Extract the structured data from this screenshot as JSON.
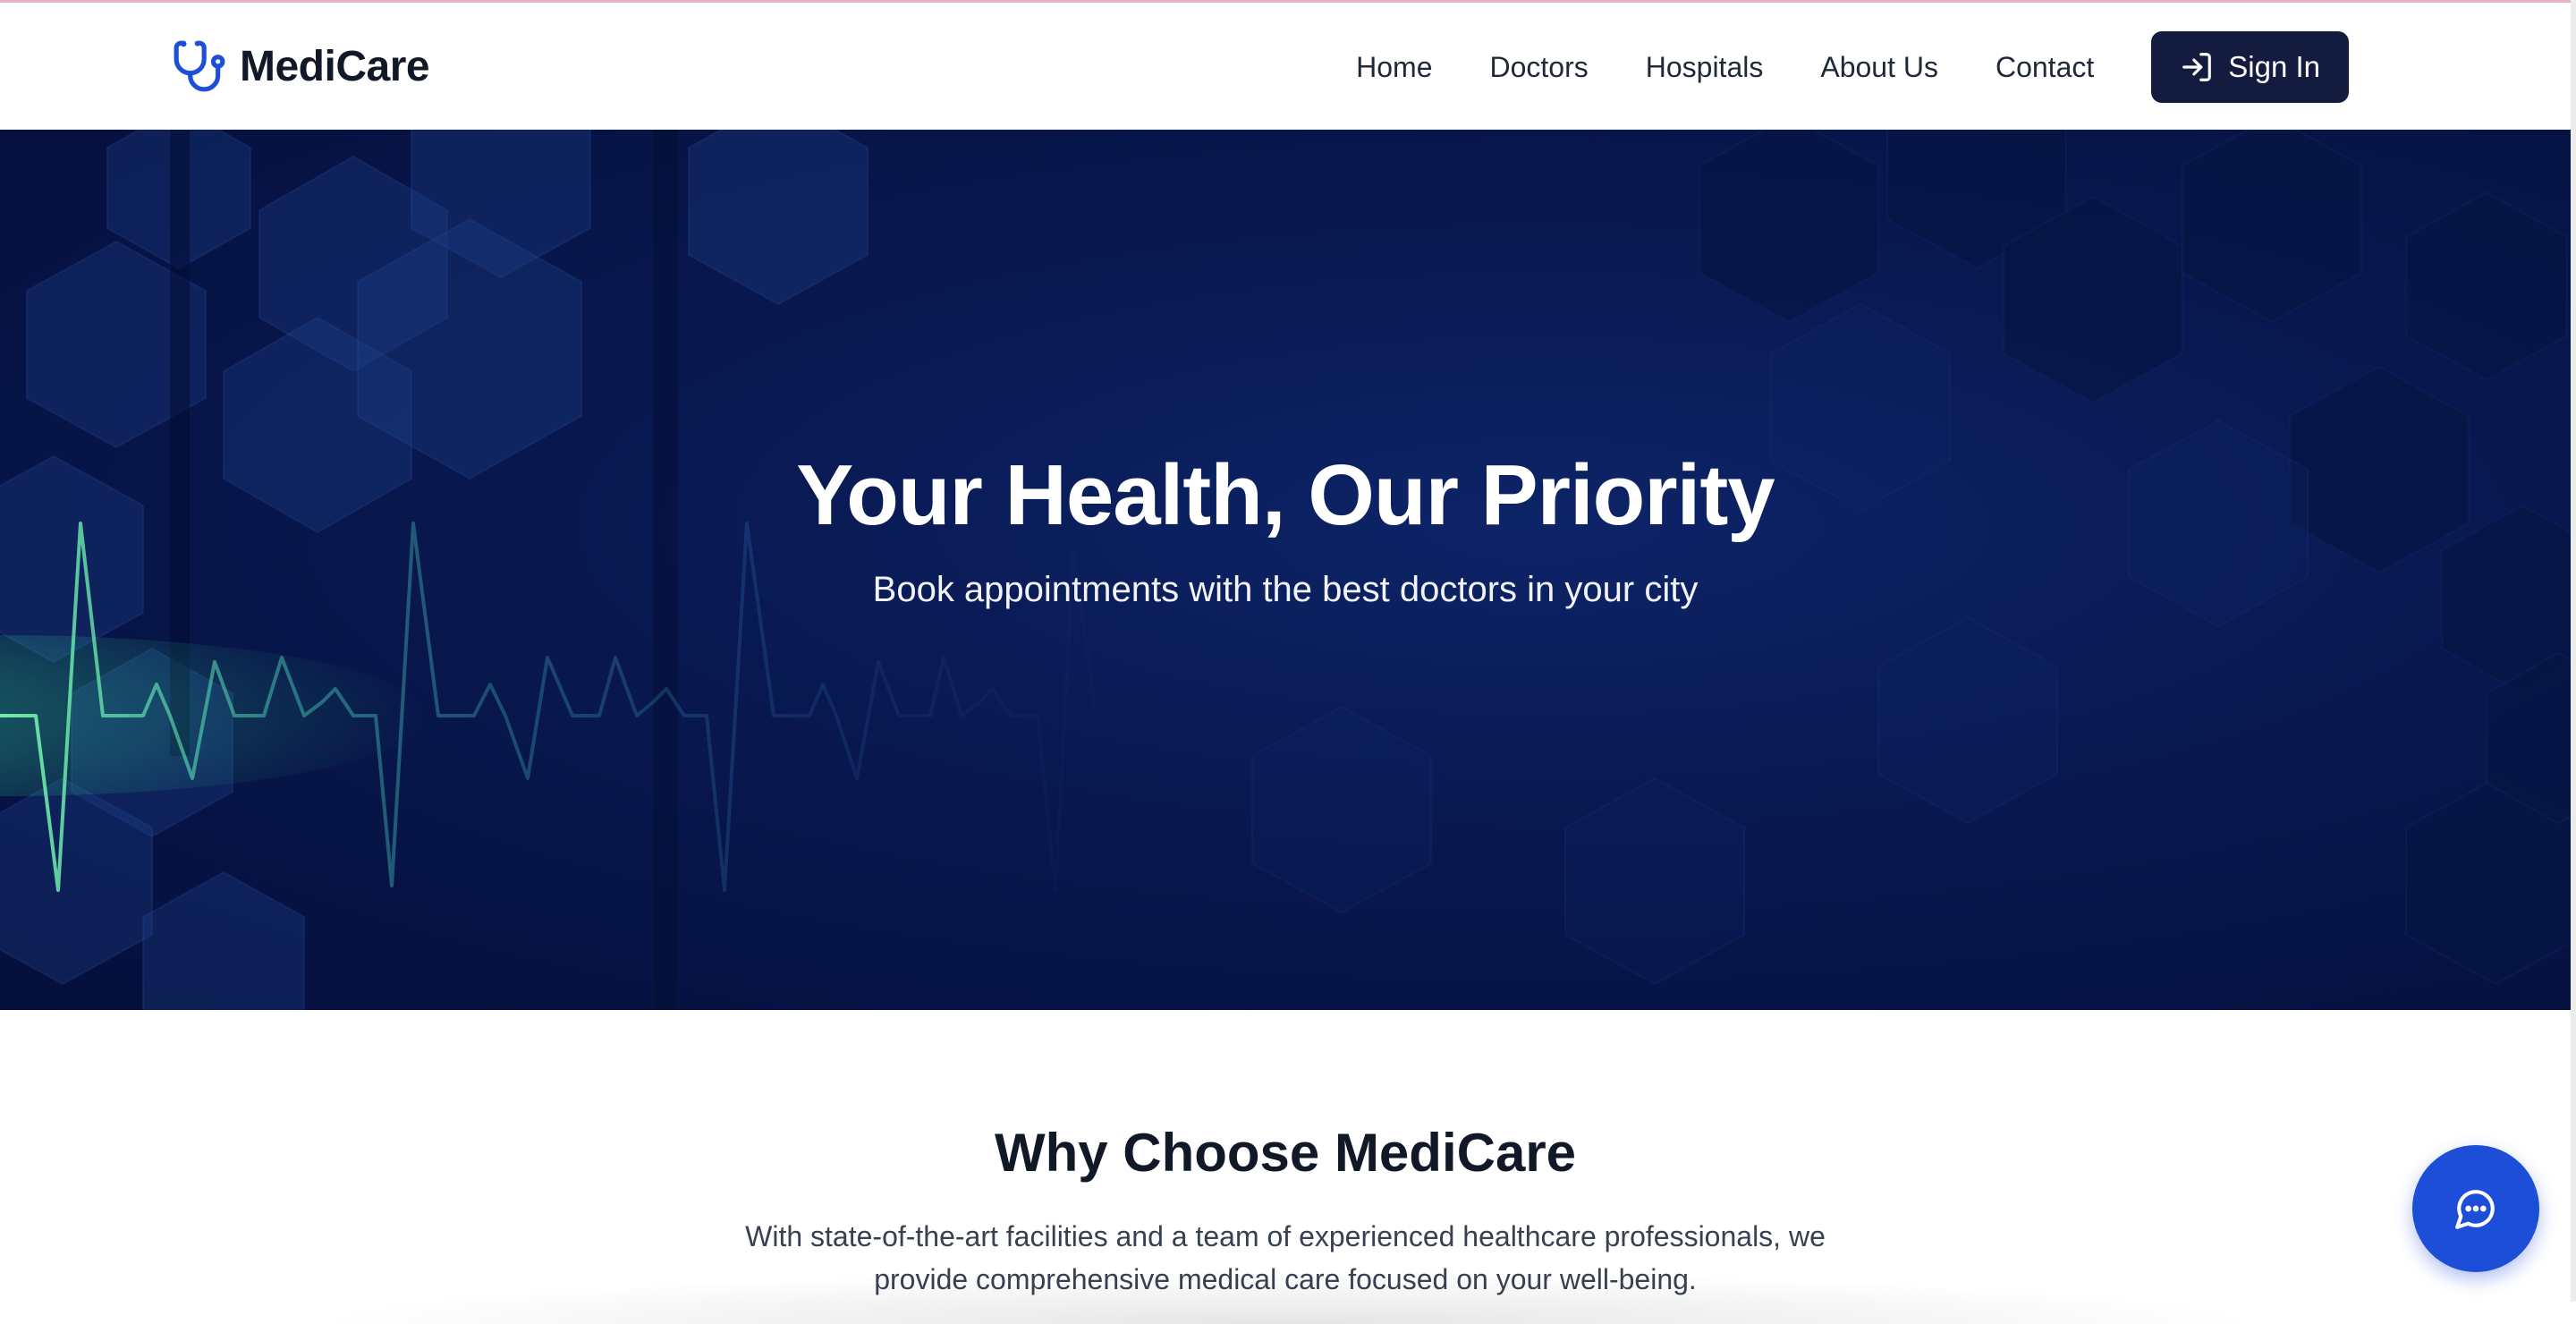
{
  "app": {
    "brand_name": "MediCare",
    "brand_icon": "stethoscope-icon",
    "accent_color": "#1d4ed8",
    "navy_color": "#131b3e"
  },
  "nav": {
    "links": [
      "Home",
      "Doctors",
      "Hospitals",
      "About Us",
      "Contact"
    ],
    "signin_label": "Sign In",
    "signin_icon": "sign-in-arrow-icon"
  },
  "hero": {
    "title": "Your Health, Our Priority",
    "subtitle": "Book appointments with the best doctors in your city"
  },
  "why": {
    "title": "Why Choose MediCare",
    "text": "With state-of-the-art facilities and a team of experienced healthcare professionals, we provide comprehensive medical care focused on your well-being."
  },
  "chat": {
    "icon": "chat-bubble-icon"
  }
}
